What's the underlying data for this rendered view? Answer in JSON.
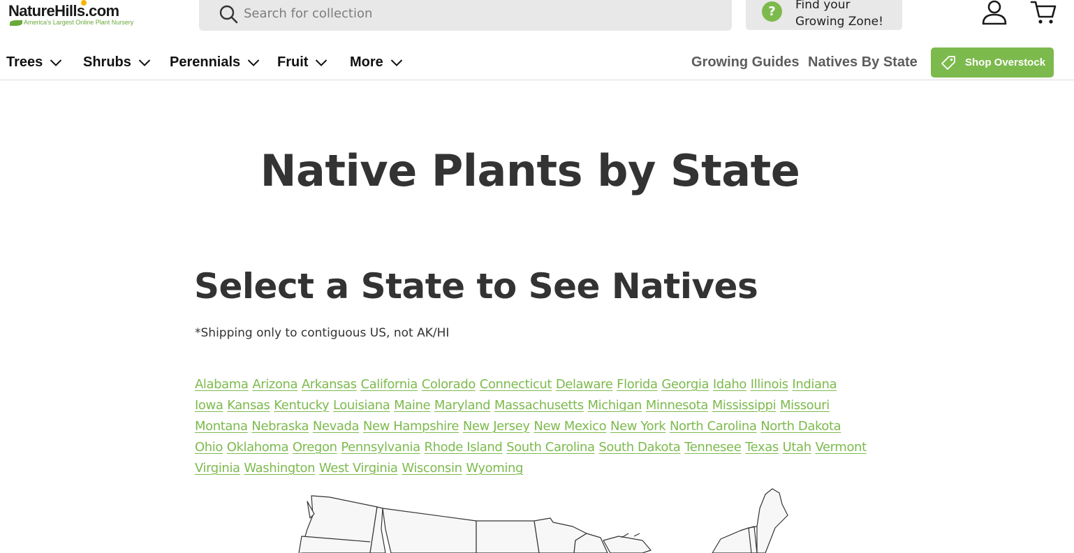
{
  "header": {
    "logo": {
      "name": "NatureHills.com",
      "tagline": "America's Largest Online Plant Nursery"
    },
    "search": {
      "placeholder": "Search for collection",
      "value": ""
    },
    "zone_finder": {
      "label": "Find your Growing Zone!",
      "icon": "question-icon"
    },
    "account_icon": "user-icon",
    "cart_icon": "cart-icon"
  },
  "nav": {
    "menu": [
      {
        "label": "Trees"
      },
      {
        "label": "Shrubs"
      },
      {
        "label": "Perennials"
      },
      {
        "label": "Fruit"
      },
      {
        "label": "More"
      }
    ],
    "links": [
      {
        "label": "Growing Guides"
      },
      {
        "label": "Natives By State"
      }
    ],
    "cta": {
      "label": "Shop Overstock",
      "icon": "tag-icon"
    }
  },
  "main": {
    "title": "Native Plants by State",
    "subtitle": "Select a State to See Natives",
    "note": "*Shipping only to contiguous US, not AK/HI",
    "states": [
      "Alabama",
      "Arizona",
      "Arkansas",
      "California",
      "Colorado",
      "Connecticut",
      "Delaware",
      "Florida",
      "Georgia",
      "Idaho",
      "Illinois",
      "Indiana",
      "Iowa",
      "Kansas",
      "Kentucky",
      "Louisiana",
      "Maine",
      "Maryland",
      "Massachusetts",
      "Michigan",
      "Minnesota",
      "Mississippi",
      "Missouri",
      "Montana",
      "Nebraska",
      "Nevada",
      "New Hampshire",
      "New Jersey",
      "New Mexico",
      "New York",
      "North Carolina",
      "North Dakota",
      "Ohio",
      "Oklahoma",
      "Oregon",
      "Pennsylvania",
      "Rhode Island",
      "South Carolina",
      "South Dakota",
      "Tennesee",
      "Texas",
      "Utah",
      "Vermont",
      "Virginia",
      "Washington",
      "West Virginia",
      "Wisconsin",
      "Wyoming"
    ]
  },
  "colors": {
    "brand_green": "#7dba4d",
    "text_dark": "#333333",
    "search_bg": "#e8e8e8"
  }
}
